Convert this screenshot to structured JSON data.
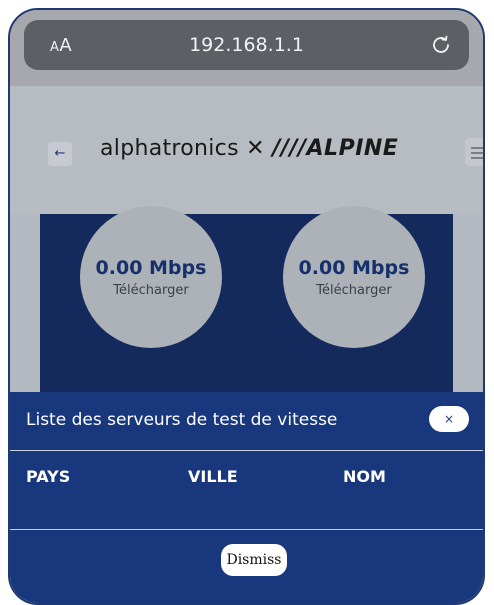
{
  "browser": {
    "text_size_label": "AA",
    "url": "192.168.1.1",
    "reload_icon": "reload-icon"
  },
  "header": {
    "back_icon": "←",
    "brand": "alphatronics",
    "brand_x": "✕",
    "brand_alpine": "////ALPINE"
  },
  "gauges": [
    {
      "value": "0.00 Mbps",
      "label": "Télécharger"
    },
    {
      "value": "0.00 Mbps",
      "label": "Télécharger"
    }
  ],
  "modal": {
    "title": "Liste des serveurs de test de vitesse",
    "close_label": "×",
    "columns": [
      "PAYS",
      "VILLE",
      "NOM"
    ],
    "dismiss_label": "Dismiss"
  }
}
